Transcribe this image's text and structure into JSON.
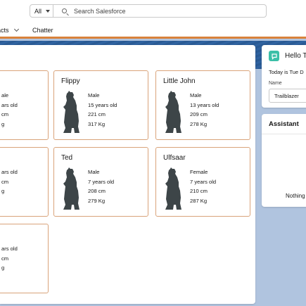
{
  "header": {
    "scope_label": "All",
    "search_placeholder": "Search Salesforce"
  },
  "nav": {
    "items": [
      {
        "label": "acts"
      },
      {
        "label": "Chatter"
      }
    ]
  },
  "bears": [
    {
      "name": "",
      "sex": "ale",
      "age": "ars old",
      "height": "cm",
      "weight": "g"
    },
    {
      "name": "Flippy",
      "sex": "Male",
      "age": "15 years old",
      "height": "221 cm",
      "weight": "317 Kg"
    },
    {
      "name": "Little John",
      "sex": "Male",
      "age": "13 years old",
      "height": "209 cm",
      "weight": "278 Kg"
    },
    {
      "name": "",
      "sex": "",
      "age": "ars old",
      "height": "cm",
      "weight": "g"
    },
    {
      "name": "Ted",
      "sex": "Male",
      "age": "7 years old",
      "height": "208 cm",
      "weight": "279 Kg"
    },
    {
      "name": "Ulfsaar",
      "sex": "Female",
      "age": "7 years old",
      "height": "210 cm",
      "weight": "287 Kg"
    },
    {
      "name": "",
      "sex": "",
      "age": "ars old",
      "height": "cm",
      "weight": "g"
    }
  ],
  "hello": {
    "title": "Hello T",
    "date_text": "Today is Tue D",
    "name_label": "Name",
    "name_value": "Trailblazer"
  },
  "assistant": {
    "title": "Assistant",
    "empty_text": "Nothing"
  },
  "colors": {
    "card_border": "#d9a37a",
    "bear_silhouette": "#3d4548",
    "nav_accent": "#d9823b",
    "hello_icon_bg": "#3bbfa7"
  }
}
